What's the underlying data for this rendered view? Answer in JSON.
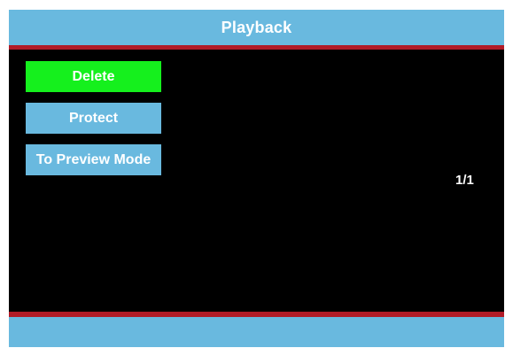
{
  "header": {
    "title": "Playback"
  },
  "menu": {
    "items": [
      {
        "label": "Delete",
        "selected": true
      },
      {
        "label": "Protect",
        "selected": false
      },
      {
        "label": "To Preview Mode",
        "selected": false
      }
    ]
  },
  "status": {
    "page_counter": "1/1"
  },
  "colors": {
    "header_bg": "#69b9df",
    "accent_bar": "#b11b27",
    "selected_item": "#15f01d",
    "unselected_item": "#69b9df",
    "content_bg": "#000000"
  }
}
